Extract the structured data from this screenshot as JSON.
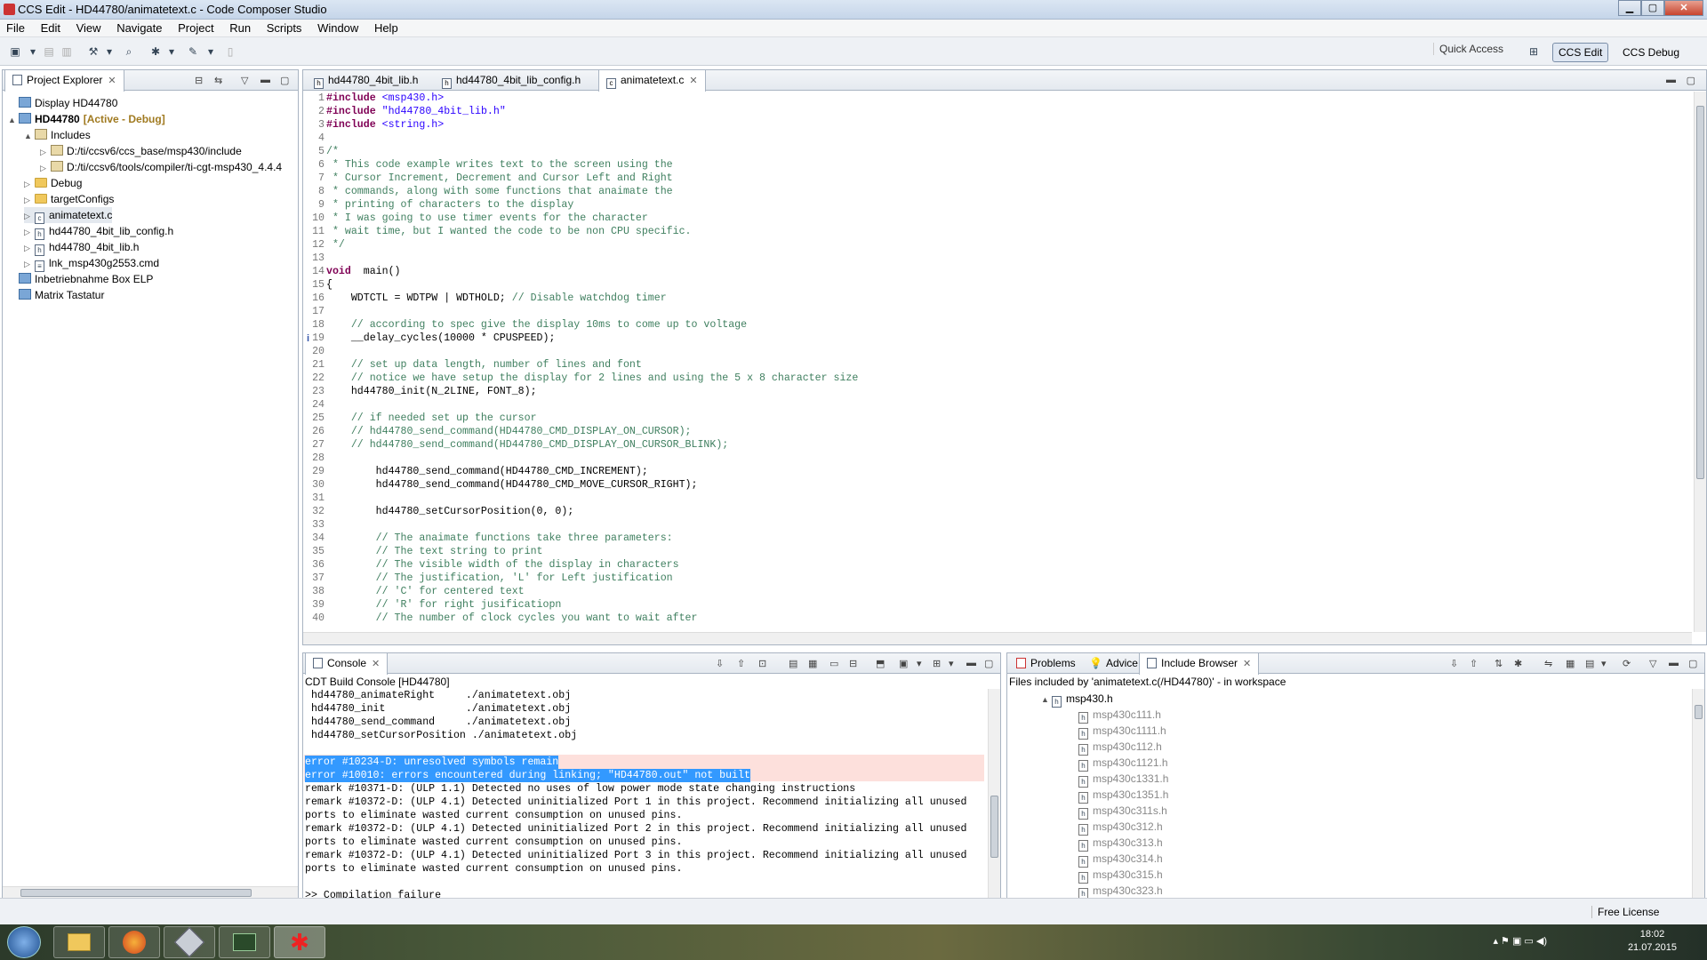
{
  "window": {
    "title": "CCS Edit - HD44780/animatetext.c - Code Composer Studio"
  },
  "menu": [
    "File",
    "Edit",
    "View",
    "Navigate",
    "Project",
    "Run",
    "Scripts",
    "Window",
    "Help"
  ],
  "toolbar": {
    "quick_access": "Quick Access",
    "perspectives": [
      "CCS Edit",
      "CCS Debug"
    ]
  },
  "project_explorer": {
    "tab": "Project Explorer",
    "items": [
      {
        "label": "Display HD44780",
        "level": 0,
        "icon": "project-icon",
        "twisty": ""
      },
      {
        "label": "HD44780",
        "suffix": "[Active - Debug]",
        "level": 0,
        "icon": "project-icon",
        "twisty": "▲"
      },
      {
        "label": "Includes",
        "level": 1,
        "icon": "includes-icon",
        "twisty": "▲"
      },
      {
        "label": "D:/ti/ccsv6/ccs_base/msp430/include",
        "level": 2,
        "icon": "include-folder-icon",
        "twisty": "▷"
      },
      {
        "label": "D:/ti/ccsv6/tools/compiler/ti-cgt-msp430_4.4.4",
        "level": 2,
        "icon": "include-folder-icon",
        "twisty": "▷"
      },
      {
        "label": "Debug",
        "level": 1,
        "icon": "folder-icon",
        "twisty": "▷"
      },
      {
        "label": "targetConfigs",
        "level": 1,
        "icon": "folder-icon",
        "twisty": "▷"
      },
      {
        "label": "animatetext.c",
        "level": 1,
        "icon": "c-file-icon",
        "twisty": "▷"
      },
      {
        "label": "hd44780_4bit_lib_config.h",
        "level": 1,
        "icon": "h-file-icon",
        "twisty": "▷"
      },
      {
        "label": "hd44780_4bit_lib.h",
        "level": 1,
        "icon": "h-file-icon",
        "twisty": "▷"
      },
      {
        "label": "lnk_msp430g2553.cmd",
        "level": 1,
        "icon": "cmd-file-icon",
        "twisty": "▷"
      },
      {
        "label": "Inbetriebnahme Box ELP",
        "level": 0,
        "icon": "project-icon",
        "twisty": ""
      },
      {
        "label": "Matrix Tastatur",
        "level": 0,
        "icon": "project-icon",
        "twisty": ""
      }
    ]
  },
  "editor": {
    "tabs": [
      "hd44780_4bit_lib.h",
      "hd44780_4bit_lib_config.h",
      "animatetext.c"
    ],
    "active_tab": 2,
    "lines": [
      {
        "n": "1",
        "parts": [
          [
            "kw",
            "#include "
          ],
          [
            "str",
            "<msp430.h>"
          ]
        ]
      },
      {
        "n": "2",
        "parts": [
          [
            "kw",
            "#include "
          ],
          [
            "str",
            "\"hd44780_4bit_lib.h\""
          ]
        ]
      },
      {
        "n": "3",
        "parts": [
          [
            "kw",
            "#include "
          ],
          [
            "str",
            "<string.h>"
          ]
        ]
      },
      {
        "n": "4",
        "parts": []
      },
      {
        "n": "5",
        "parts": [
          [
            "cm",
            "/*"
          ]
        ]
      },
      {
        "n": "6",
        "parts": [
          [
            "cm",
            " * This code example writes text to the screen using the"
          ]
        ]
      },
      {
        "n": "7",
        "parts": [
          [
            "cm",
            " * Cursor Increment, Decrement and Cursor Left and Right"
          ]
        ]
      },
      {
        "n": "8",
        "parts": [
          [
            "cm",
            " * commands, along with some functions that anaimate the"
          ]
        ]
      },
      {
        "n": "9",
        "parts": [
          [
            "cm",
            " * printing of characters to the display"
          ]
        ]
      },
      {
        "n": "10",
        "parts": [
          [
            "cm",
            " * I was going to use timer events for the character"
          ]
        ]
      },
      {
        "n": "11",
        "parts": [
          [
            "cm",
            " * wait time, but I wanted the code to be non CPU specific."
          ]
        ]
      },
      {
        "n": "12",
        "parts": [
          [
            "cm",
            " */"
          ]
        ]
      },
      {
        "n": "13",
        "parts": []
      },
      {
        "n": "14",
        "parts": [
          [
            "kw",
            "void"
          ],
          [
            "",
            "  main()"
          ]
        ]
      },
      {
        "n": "15",
        "parts": [
          [
            "",
            "{"
          ]
        ]
      },
      {
        "n": "16",
        "parts": [
          [
            "",
            "    WDTCTL = WDTPW | WDTHOLD; "
          ],
          [
            "cm",
            "// Disable watchdog timer"
          ]
        ]
      },
      {
        "n": "17",
        "parts": []
      },
      {
        "n": "18",
        "parts": [
          [
            "cm",
            "    // according to spec give the display 10ms to come up to voltage"
          ]
        ]
      },
      {
        "n": "19",
        "parts": [
          [
            "",
            "    __delay_cycles(10000 * CPUSPEED);"
          ]
        ]
      },
      {
        "n": "20",
        "parts": []
      },
      {
        "n": "21",
        "parts": [
          [
            "cm",
            "    // set up data length, number of lines and font"
          ]
        ]
      },
      {
        "n": "22",
        "parts": [
          [
            "cm",
            "    // notice we have setup the display for 2 lines and using the 5 x 8 character size"
          ]
        ]
      },
      {
        "n": "23",
        "parts": [
          [
            "",
            "    hd44780_init(N_2LINE, FONT_8);"
          ]
        ]
      },
      {
        "n": "24",
        "parts": []
      },
      {
        "n": "25",
        "parts": [
          [
            "cm",
            "    // if needed set up the cursor"
          ]
        ]
      },
      {
        "n": "26",
        "parts": [
          [
            "cm",
            "    // hd44780_send_command(HD44780_CMD_DISPLAY_ON_CURSOR);"
          ]
        ]
      },
      {
        "n": "27",
        "parts": [
          [
            "cm",
            "    // hd44780_send_command(HD44780_CMD_DISPLAY_ON_CURSOR_BLINK);"
          ]
        ]
      },
      {
        "n": "28",
        "parts": []
      },
      {
        "n": "29",
        "parts": [
          [
            "",
            "        hd44780_send_command(HD44780_CMD_INCREMENT);"
          ]
        ]
      },
      {
        "n": "30",
        "parts": [
          [
            "",
            "        hd44780_send_command(HD44780_CMD_MOVE_CURSOR_RIGHT);"
          ]
        ]
      },
      {
        "n": "31",
        "parts": []
      },
      {
        "n": "32",
        "parts": [
          [
            "",
            "        hd44780_setCursorPosition(0, 0);"
          ]
        ]
      },
      {
        "n": "33",
        "parts": []
      },
      {
        "n": "34",
        "parts": [
          [
            "cm",
            "        // The anaimate functions take three parameters:"
          ]
        ]
      },
      {
        "n": "35",
        "parts": [
          [
            "cm",
            "        // The text string to print"
          ]
        ]
      },
      {
        "n": "36",
        "parts": [
          [
            "cm",
            "        // The visible width of the display in characters"
          ]
        ]
      },
      {
        "n": "37",
        "parts": [
          [
            "cm",
            "        // The justification, 'L' for Left justification"
          ]
        ]
      },
      {
        "n": "38",
        "parts": [
          [
            "cm",
            "        // 'C' for centered text"
          ]
        ]
      },
      {
        "n": "39",
        "parts": [
          [
            "cm",
            "        // 'R' for right jusificatiopn"
          ]
        ]
      },
      {
        "n": "40",
        "parts": [
          [
            "cm",
            "        // The number of clock cycles you want to wait after"
          ]
        ]
      }
    ]
  },
  "console": {
    "tab": "Console",
    "header": "CDT Build Console [HD44780]",
    "lines": [
      " hd44780_animateRight     ./animatetext.obj",
      " hd44780_init             ./animatetext.obj",
      " hd44780_send_command     ./animatetext.obj",
      " hd44780_setCursorPosition ./animatetext.obj",
      "",
      "error #10234-D: unresolved symbols remain",
      "error #10010: errors encountered during linking; \"HD44780.out\" not built",
      "remark #10371-D: (ULP 1.1) Detected no uses of low power mode state changing instructions",
      "remark #10372-D: (ULP 4.1) Detected uninitialized Port 1 in this project. Recommend initializing all unused",
      "ports to eliminate wasted current consumption on unused pins.",
      "remark #10372-D: (ULP 4.1) Detected uninitialized Port 2 in this project. Recommend initializing all unused",
      "ports to eliminate wasted current consumption on unused pins.",
      "remark #10372-D: (ULP 4.1) Detected uninitialized Port 3 in this project. Recommend initializing all unused",
      "ports to eliminate wasted current consumption on unused pins.",
      "",
      ">> Compilation failure"
    ]
  },
  "include_browser": {
    "tabs": [
      "Problems",
      "Advice",
      "Include Browser"
    ],
    "header": "Files included by 'animatetext.c(/HD44780)' - in workspace",
    "root": "msp430.h",
    "files": [
      "msp430c111.h",
      "msp430c1111.h",
      "msp430c112.h",
      "msp430c1121.h",
      "msp430c1331.h",
      "msp430c1351.h",
      "msp430c311s.h",
      "msp430c312.h",
      "msp430c313.h",
      "msp430c314.h",
      "msp430c315.h",
      "msp430c323.h"
    ]
  },
  "status": {
    "license": "Free License"
  },
  "taskbar": {
    "time": "18:02",
    "date": "21.07.2015"
  }
}
